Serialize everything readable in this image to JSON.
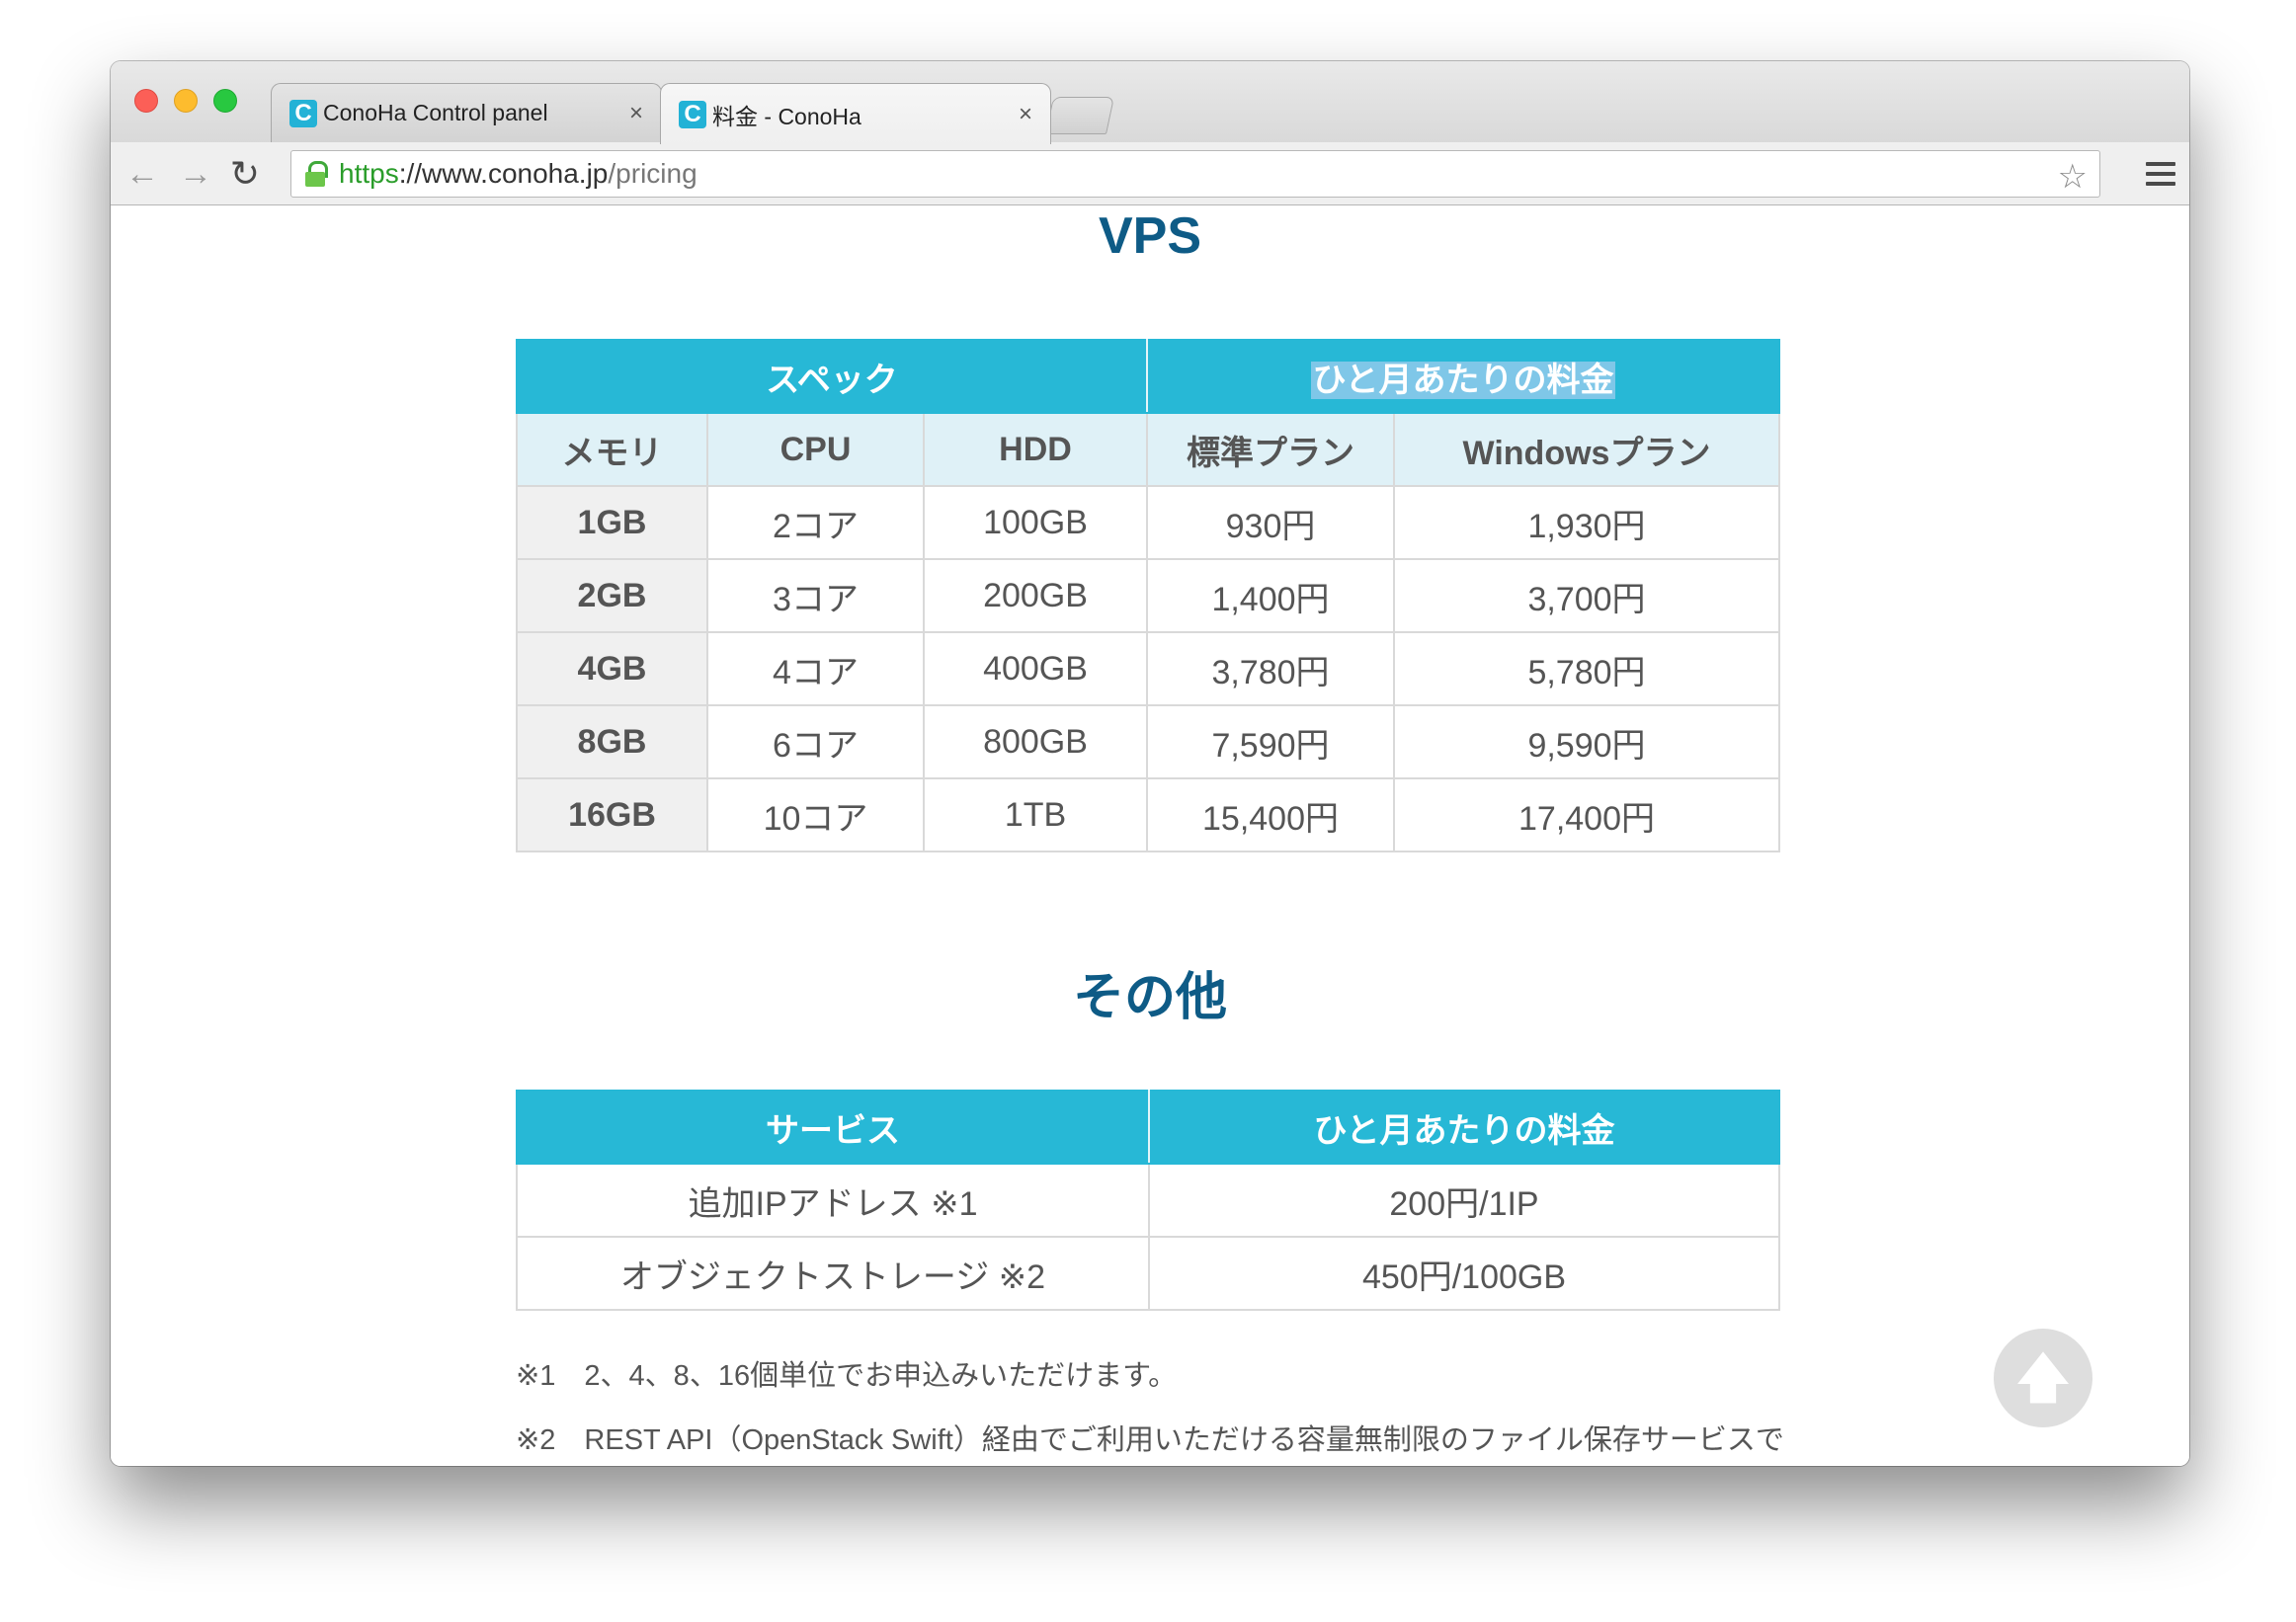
{
  "browser": {
    "tabs": [
      {
        "favicon": "C",
        "title": "ConoHa Control panel",
        "close": "×"
      },
      {
        "favicon": "C",
        "title": "料金 - ConoHa",
        "close": "×"
      }
    ],
    "url": {
      "scheme": "https",
      "sep": "://",
      "host": "www.conoha.jp",
      "path": "/pricing"
    },
    "icons": {
      "back": "arrow-left-icon",
      "forward": "arrow-right-icon",
      "reload": "reload-icon",
      "bookmark": "star-icon",
      "menu": "hamburger-menu-icon",
      "lock": "lock-icon"
    }
  },
  "vps": {
    "heading": "VPS",
    "group_headers": [
      "スペック",
      "ひと月あたりの料金"
    ],
    "columns": [
      "メモリ",
      "CPU",
      "HDD",
      "標準プラン",
      "Windowsプラン"
    ],
    "rows": [
      [
        "1GB",
        "2コア",
        "100GB",
        "930円",
        "1,930円"
      ],
      [
        "2GB",
        "3コア",
        "200GB",
        "1,400円",
        "3,700円"
      ],
      [
        "4GB",
        "4コア",
        "400GB",
        "3,780円",
        "5,780円"
      ],
      [
        "8GB",
        "6コア",
        "800GB",
        "7,590円",
        "9,590円"
      ],
      [
        "16GB",
        "10コア",
        "1TB",
        "15,400円",
        "17,400円"
      ]
    ]
  },
  "other": {
    "heading": "その他",
    "columns": [
      "サービス",
      "ひと月あたりの料金"
    ],
    "rows": [
      [
        "追加IPアドレス ※1",
        "200円/1IP"
      ],
      [
        "オブジェクトストレージ ※2",
        "450円/100GB"
      ]
    ]
  },
  "notes": [
    "※1　2、4、8、16個単位でお申込みいただけます。",
    "※2　REST API（OpenStack Swift）経由でご利用いただける容量無制限のファイル保存サービスで"
  ],
  "scroll_top_icon": "arrow-up-icon",
  "colors": {
    "header": "#27b8d6",
    "subheader": "#dff1f7",
    "heading": "#0e5b86"
  }
}
